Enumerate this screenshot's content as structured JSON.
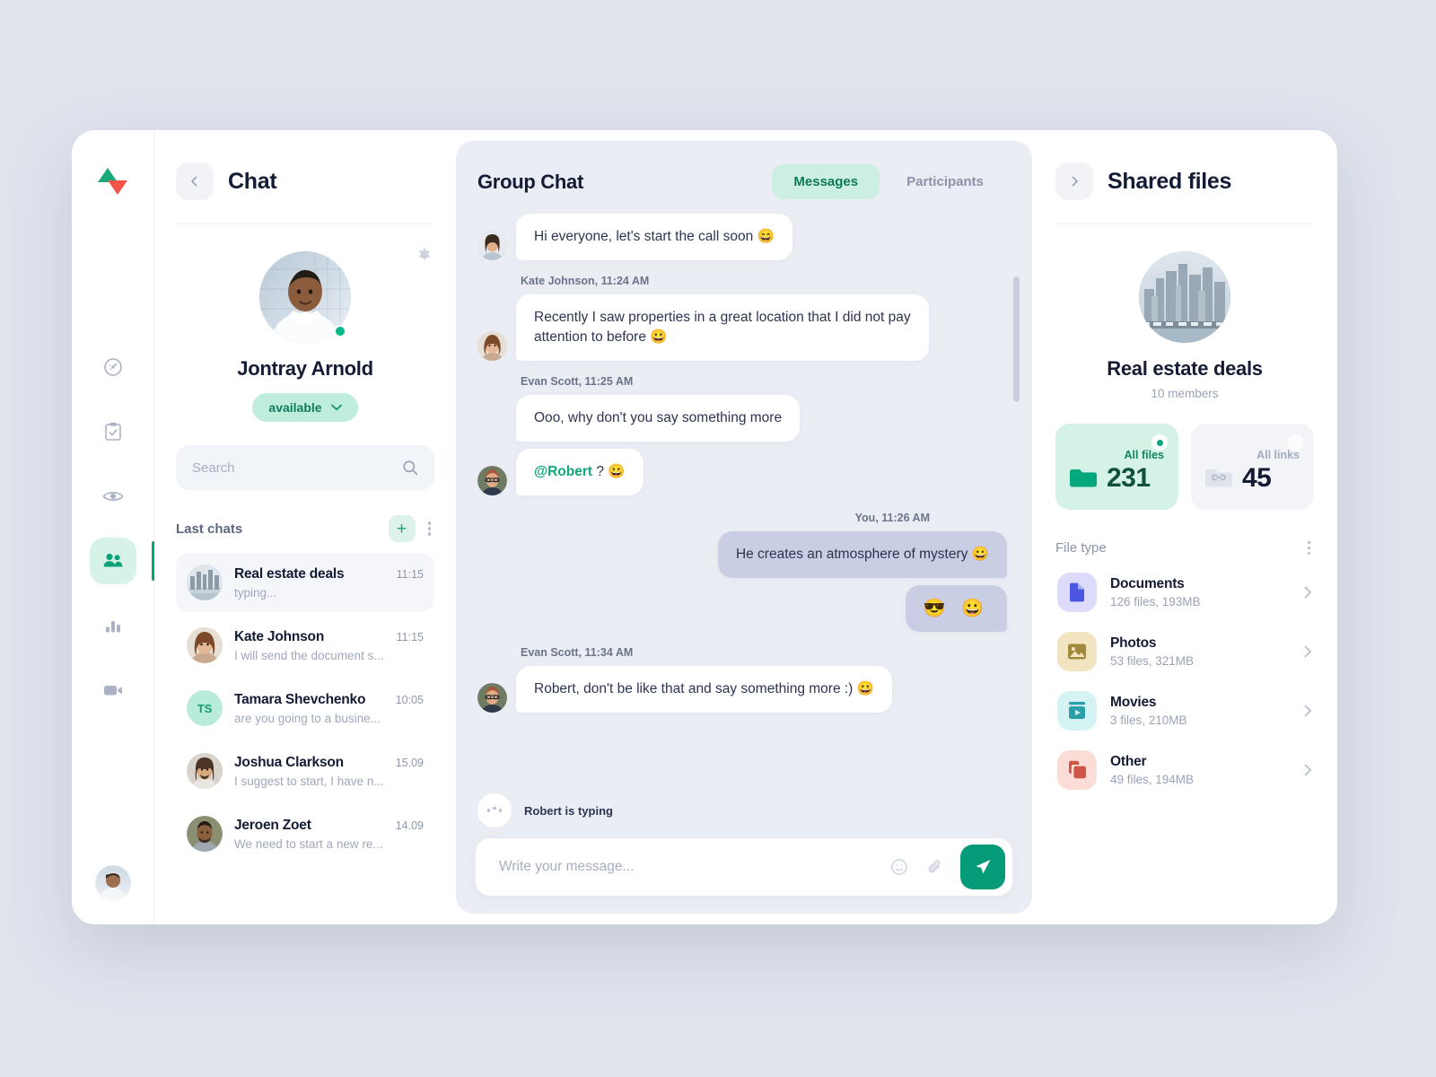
{
  "app": {
    "logo_name": "logo-triangles",
    "logo_colors": {
      "up": "#18a87a",
      "down": "#f4554a"
    }
  },
  "rail": {
    "items": [
      {
        "name": "dashboard-icon",
        "active": false
      },
      {
        "name": "tasks-icon",
        "active": false
      },
      {
        "name": "eye-icon",
        "active": false
      },
      {
        "name": "contacts-icon",
        "active": true
      },
      {
        "name": "analytics-icon",
        "active": false
      },
      {
        "name": "video-icon",
        "active": false
      }
    ],
    "accent": "#00a779"
  },
  "chat_panel": {
    "back_label": "‹",
    "title": "Chat",
    "profile": {
      "name": "Jontray Arnold",
      "status": "available",
      "status_caret": "⌄",
      "online": true
    },
    "search": {
      "value": "",
      "placeholder": "Search"
    },
    "last_chats_label": "Last chats",
    "add_label": "+",
    "chats": [
      {
        "name": "Real estate deals",
        "time": "11:15",
        "preview": "typing...",
        "selected": true,
        "avatar_type": "photo-city",
        "initials": ""
      },
      {
        "name": "Kate Johnson",
        "time": "11:15",
        "preview": "I will send the document s...",
        "selected": false,
        "avatar_type": "photo-woman",
        "initials": ""
      },
      {
        "name": "Tamara Shevchenko",
        "time": "10:05",
        "preview": "are you going to a busine...",
        "selected": false,
        "avatar_type": "initials",
        "initials": "TS"
      },
      {
        "name": "Joshua Clarkson",
        "time": "15.09",
        "preview": "I suggest to start, I have n...",
        "selected": false,
        "avatar_type": "photo-man1",
        "initials": ""
      },
      {
        "name": "Jeroen Zoet",
        "time": "14.09",
        "preview": "We need to start a new re...",
        "selected": false,
        "avatar_type": "photo-man2",
        "initials": ""
      }
    ]
  },
  "conversation": {
    "title": "Group Chat",
    "tabs": [
      {
        "label": "Messages",
        "active": true
      },
      {
        "label": "Participants",
        "active": false
      }
    ],
    "messages": [
      {
        "id": "m0",
        "meta": "",
        "text": "Hi everyone, let's start the call soon 😄",
        "side": "in",
        "avatar": "photo-woman2",
        "clipped": true
      },
      {
        "id": "m1",
        "meta": "Kate Johnson, 11:24 AM",
        "text": "Recently I saw properties in a great location that I did not pay attention to before 😀",
        "side": "in",
        "avatar": "photo-woman"
      },
      {
        "id": "m2",
        "meta": "Evan Scott, 11:25 AM",
        "text": "Ooo, why don't you say something more",
        "side": "in",
        "avatar": "none"
      },
      {
        "id": "m3",
        "meta": "",
        "text": "@Robert ? 😀",
        "mention": "@Robert",
        "rest": " ? 😀",
        "side": "in",
        "avatar": "photo-man3"
      },
      {
        "id": "m4",
        "meta": "You, 11:26 AM",
        "text": "He creates an atmosphere of mystery 😀",
        "side": "out"
      },
      {
        "id": "m5",
        "meta": "",
        "text": "😎 😀",
        "side": "out",
        "emoji_only": true
      },
      {
        "id": "m6",
        "meta": "Evan Scott, 11:34 AM",
        "text": "Robert, don't be like that and say something more :) 😀",
        "side": "in",
        "avatar": "photo-man3"
      }
    ],
    "typing_indicator": "Robert is typing",
    "composer": {
      "value": "",
      "placeholder": "Write your message...",
      "emoji_icon": "emoji-icon",
      "attach_icon": "attachment-icon",
      "send_icon": "send-icon"
    }
  },
  "shared_files": {
    "forward_label": "›",
    "title": "Shared files",
    "group": {
      "name": "Real estate deals",
      "members": "10 members"
    },
    "stats": [
      {
        "label": "All files",
        "value": "231",
        "icon": "folder-icon",
        "primary": true,
        "badge": "dot"
      },
      {
        "label": "All links",
        "value": "45",
        "icon": "link-folder-icon",
        "primary": false,
        "badge": "plain"
      }
    ],
    "file_type_label": "File type",
    "file_types": [
      {
        "name": "Documents",
        "sub": "126 files, 193MB",
        "icon": "document-icon",
        "bg": "#dcdcfa",
        "fg": "#4b55e0"
      },
      {
        "name": "Photos",
        "sub": "53 files, 321MB",
        "icon": "image-icon",
        "bg": "#f2e4c0",
        "fg": "#a08a3c"
      },
      {
        "name": "Movies",
        "sub": "3 files, 210MB",
        "icon": "movie-icon",
        "bg": "#d6f3f4",
        "fg": "#2a9fa8"
      },
      {
        "name": "Other",
        "sub": "49 files, 194MB",
        "icon": "copy-icon",
        "bg": "#fbdcd6",
        "fg": "#cf5646"
      }
    ],
    "chevron": "›"
  },
  "colors": {
    "accent_green": "#069b78",
    "accent_light": "#d5f2e7",
    "bg_page": "#dfe3ec",
    "bg_chat": "#eaedf3",
    "bubble_out": "#c9cee4",
    "text_dark": "#141b34"
  }
}
